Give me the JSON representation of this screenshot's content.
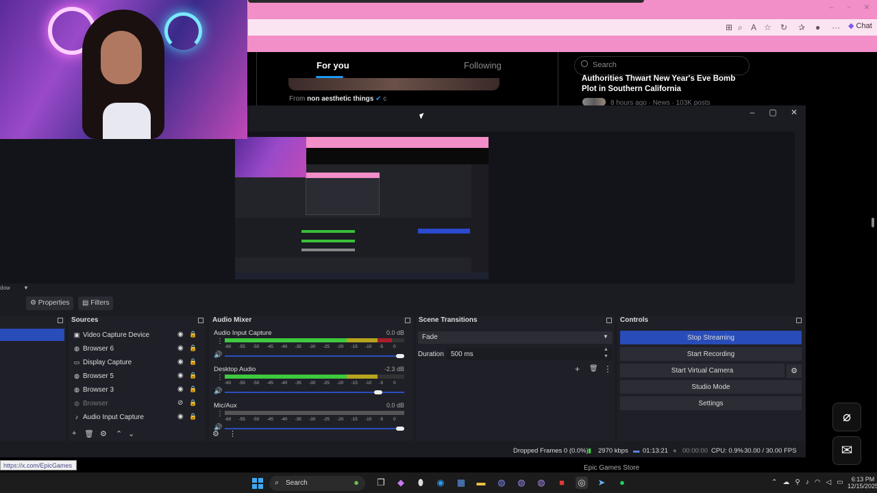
{
  "browser": {
    "chat_label": "Chat",
    "tabs": {
      "for_you": "For you",
      "following": "Following"
    },
    "post": {
      "from_prefix": "From",
      "from_account": "non aesthetic things"
    },
    "search_placeholder": "Search",
    "trend": {
      "title": "Authorities Thwart New Year's Eve Bomb Plot in Southern California",
      "meta": "8 hours ago · News · 103K posts"
    },
    "status_url": "https://x.com/EpicGames",
    "epic_card": "Epic Games Store"
  },
  "obs": {
    "toolbar": {
      "window_label": "dow",
      "properties": "Properties",
      "filters": "Filters"
    },
    "sources_title": "Sources",
    "sources": [
      {
        "label": "Video Capture Device",
        "icon": "camera-icon",
        "visible": true
      },
      {
        "label": "Browser 6",
        "icon": "globe-icon",
        "visible": true
      },
      {
        "label": "Display Capture",
        "icon": "monitor-icon",
        "visible": true
      },
      {
        "label": "Browser 5",
        "icon": "globe-icon",
        "visible": true
      },
      {
        "label": "Browser 3",
        "icon": "globe-icon",
        "visible": true
      },
      {
        "label": "Browser",
        "icon": "globe-icon",
        "visible": false
      },
      {
        "label": "Audio Input Capture",
        "icon": "mic-icon",
        "visible": true
      }
    ],
    "mixer_title": "Audio Mixer",
    "mixer": [
      {
        "name": "Audio Input Capture",
        "db": "0.0 dB",
        "level": 0.93,
        "volume": 1.0
      },
      {
        "name": "Desktop Audio",
        "db": "-2.3 dB",
        "level": 0.85,
        "volume": 0.87
      },
      {
        "name": "Mic/Aux",
        "db": "0.0 dB",
        "level": 0.0,
        "volume": 1.0
      }
    ],
    "meter_ticks": [
      "-60",
      "-55",
      "-50",
      "-45",
      "-40",
      "-35",
      "-30",
      "-25",
      "-20",
      "-15",
      "-10",
      "-5",
      "0"
    ],
    "transitions_title": "Scene Transitions",
    "transition": "Fade",
    "duration_label": "Duration",
    "duration_value": "500 ms",
    "controls_title": "Controls",
    "controls": {
      "stop_streaming": "Stop Streaming",
      "start_recording": "Start Recording",
      "start_virtual_camera": "Start Virtual Camera",
      "studio_mode": "Studio Mode",
      "settings": "Settings"
    },
    "status": {
      "dropped": "Dropped Frames 0 (0.0%)",
      "bitrate": "2970 kbps",
      "stream_time": "01:13:21",
      "rec_time": "00:00:00",
      "cpu": "CPU: 0.9%",
      "fps": "30.00 / 30.00 FPS"
    }
  },
  "taskbar": {
    "search": "Search",
    "time": "6:13 PM",
    "date": "12/15/2025"
  },
  "colors": {
    "accent": "#284cb8",
    "browser_pink": "#f28ec8",
    "meter_green": "#3ec93e"
  }
}
